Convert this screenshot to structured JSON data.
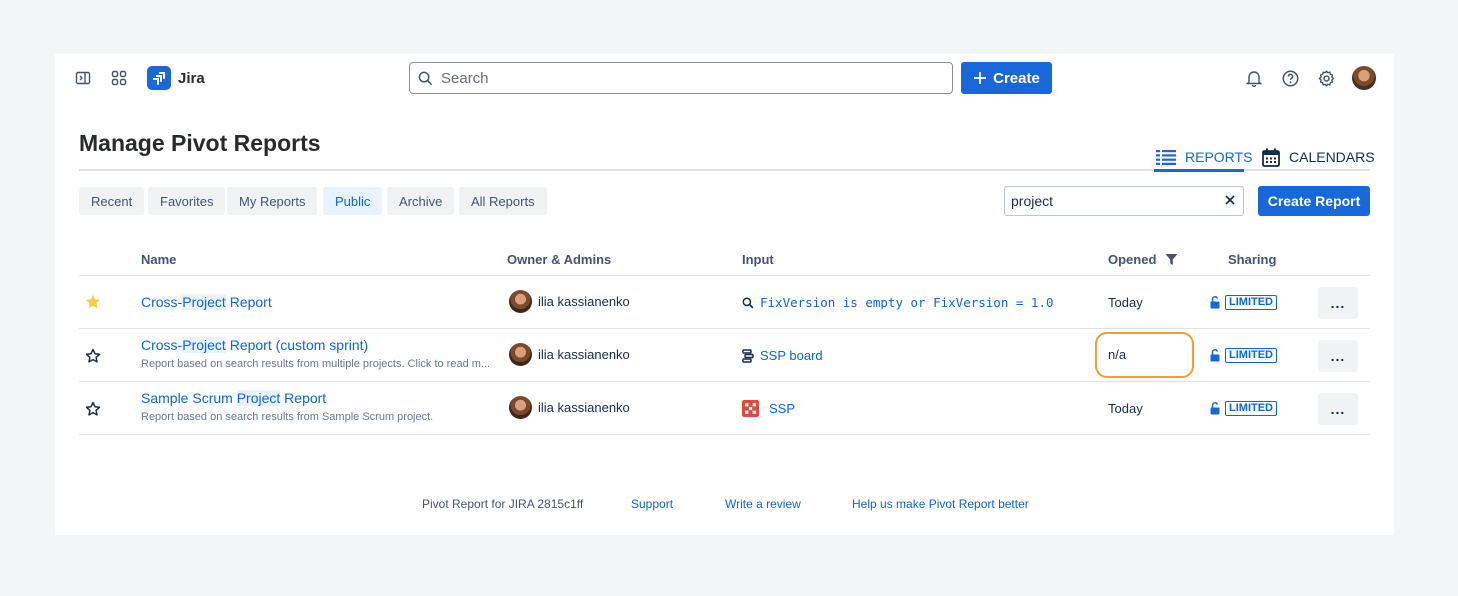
{
  "nav": {
    "app_name": "Jira",
    "search_placeholder": "Search",
    "create_label": "Create"
  },
  "page": {
    "title": "Manage Pivot Reports",
    "view_tabs": {
      "reports": "REPORTS",
      "calendars": "CALENDARS"
    },
    "filter_tabs": [
      "Recent",
      "Favorites",
      "My Reports",
      "Public",
      "Archive",
      "All Reports"
    ],
    "active_filter_tab": "Public",
    "filter_value": "project",
    "create_report_label": "Create Report"
  },
  "table": {
    "headers": {
      "name": "Name",
      "owner": "Owner & Admins",
      "input": "Input",
      "opened": "Opened",
      "sharing": "Sharing"
    },
    "rows": [
      {
        "favorite": true,
        "name_parts": [
          "Cross-",
          "Project",
          " Report"
        ],
        "description": "",
        "owner": "ilia kassianenko",
        "input_icon": "search-icon",
        "input": "FixVersion is empty or FixVersion = 1.0",
        "opened": "Today",
        "sharing": "LIMITED"
      },
      {
        "favorite": false,
        "name_parts": [
          "Cross-",
          "Project",
          " Report (custom sprint)"
        ],
        "description": "Report based on search results from multiple projects. Click to read m...",
        "owner": "ilia kassianenko",
        "input_icon": "board-icon",
        "input": "SSP board",
        "opened": "n/a",
        "sharing": "LIMITED"
      },
      {
        "favorite": false,
        "name_parts": [
          "Sample Scrum ",
          "Project",
          " Report"
        ],
        "description": "Report based on search results from Sample Scrum project.",
        "owner": "ilia kassianenko",
        "input_icon": "project-icon",
        "input": "SSP",
        "opened": "Today",
        "sharing": "LIMITED"
      }
    ],
    "more_label": "..."
  },
  "footer": {
    "version": "Pivot Report for JIRA 2815c1ff",
    "support": "Support",
    "review": "Write a review",
    "feedback": "Help us make Pivot Report better"
  },
  "colors": {
    "accent": "#1868db",
    "link": "#0c66e4",
    "highlight_ring": "#f0a02e",
    "star_fav": "#f5cd47"
  }
}
